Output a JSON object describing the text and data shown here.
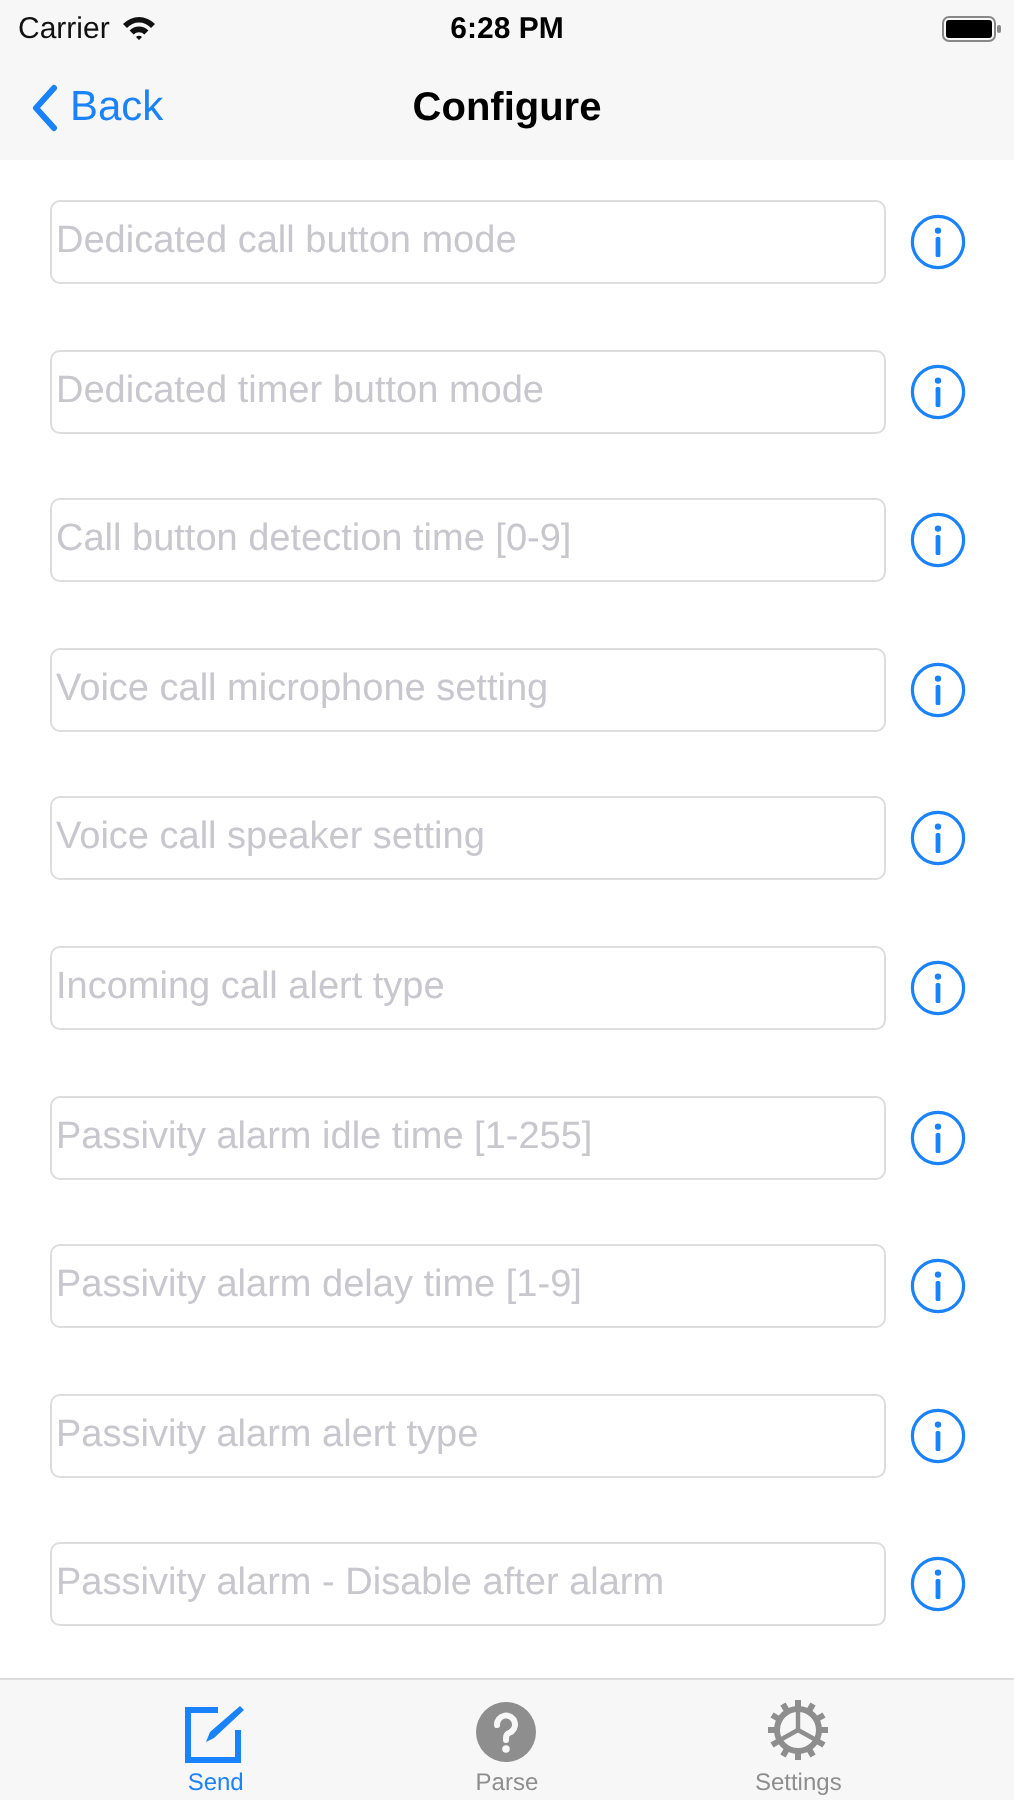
{
  "status_bar": {
    "carrier": "Carrier",
    "time": "6:28 PM"
  },
  "nav": {
    "back": "Back",
    "title": "Configure"
  },
  "fields": [
    {
      "placeholder": "Dedicated call button mode"
    },
    {
      "placeholder": "Dedicated timer button mode"
    },
    {
      "placeholder": "Call button detection time [0-9]"
    },
    {
      "placeholder": "Voice call microphone setting"
    },
    {
      "placeholder": "Voice call speaker setting"
    },
    {
      "placeholder": "Incoming call alert type"
    },
    {
      "placeholder": "Passivity alarm idle time [1-255]"
    },
    {
      "placeholder": "Passivity alarm delay time [1-9]"
    },
    {
      "placeholder": "Passivity alarm alert type"
    },
    {
      "placeholder": "Passivity alarm - Disable after alarm"
    }
  ],
  "tabs": [
    {
      "label": "Send",
      "kind": "compose",
      "selected": true
    },
    {
      "label": "Parse",
      "kind": "help",
      "selected": false
    },
    {
      "label": "Settings",
      "kind": "gear",
      "selected": false
    }
  ]
}
